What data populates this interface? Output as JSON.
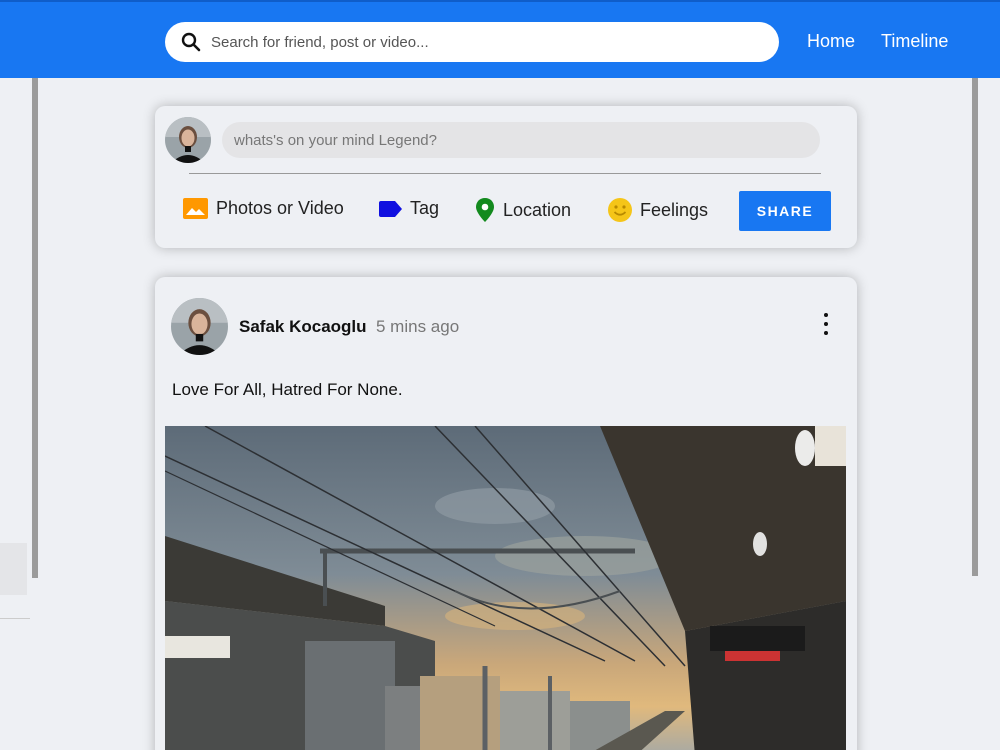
{
  "topbar": {
    "search_placeholder": "Search for friend, post or video...",
    "nav": [
      "Home",
      "Timeline"
    ],
    "color": "#1877f2"
  },
  "share": {
    "placeholder": "whats's on your mind Legend?",
    "options": [
      {
        "label": "Photos or Video",
        "icon": "photo-icon",
        "color": "#ff9800"
      },
      {
        "label": "Tag",
        "icon": "label-icon",
        "color": "#1010e0"
      },
      {
        "label": "Location",
        "icon": "location-pin-icon",
        "color": "#138a1e"
      },
      {
        "label": "Feelings",
        "icon": "smiley-icon",
        "color": "#f5c518"
      }
    ],
    "button": "SHARE"
  },
  "post": {
    "username": "Safak Kocaoglu",
    "time": "5 mins ago",
    "text": "Love For All, Hatred For None."
  }
}
